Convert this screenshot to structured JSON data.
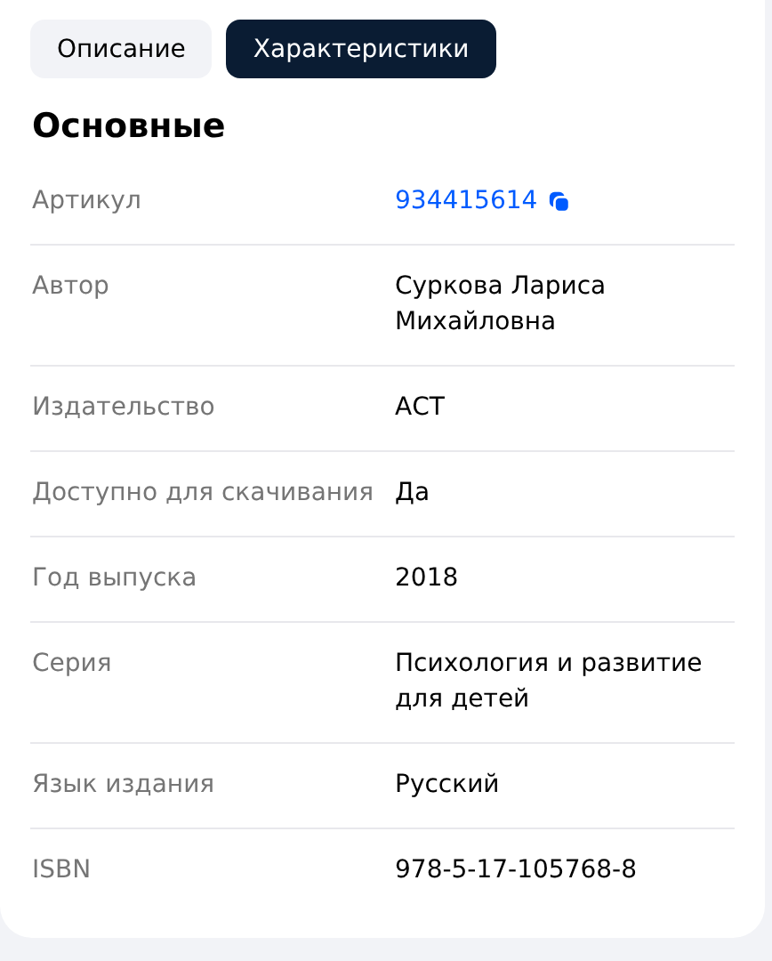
{
  "tabs": [
    {
      "label": "Описание",
      "selected": false
    },
    {
      "label": "Характеристики",
      "selected": true
    }
  ],
  "section_title": "Основные",
  "rows": [
    {
      "label": "Артикул",
      "value": "934415614",
      "kind": "copyable"
    },
    {
      "label": "Автор",
      "value": "Суркова Лариса Михайловна",
      "kind": "text"
    },
    {
      "label": "Издательство",
      "value": "АСТ",
      "kind": "text"
    },
    {
      "label": "Доступно для скачивания",
      "value": "Да",
      "kind": "text"
    },
    {
      "label": "Год выпуска",
      "value": "2018",
      "kind": "text"
    },
    {
      "label": "Серия",
      "value": "Психология и развитие для детей",
      "kind": "text"
    },
    {
      "label": "Язык издания",
      "value": "Русский",
      "kind": "text"
    },
    {
      "label": "ISBN",
      "value": "978-5-17-105768-8",
      "kind": "text"
    }
  ]
}
